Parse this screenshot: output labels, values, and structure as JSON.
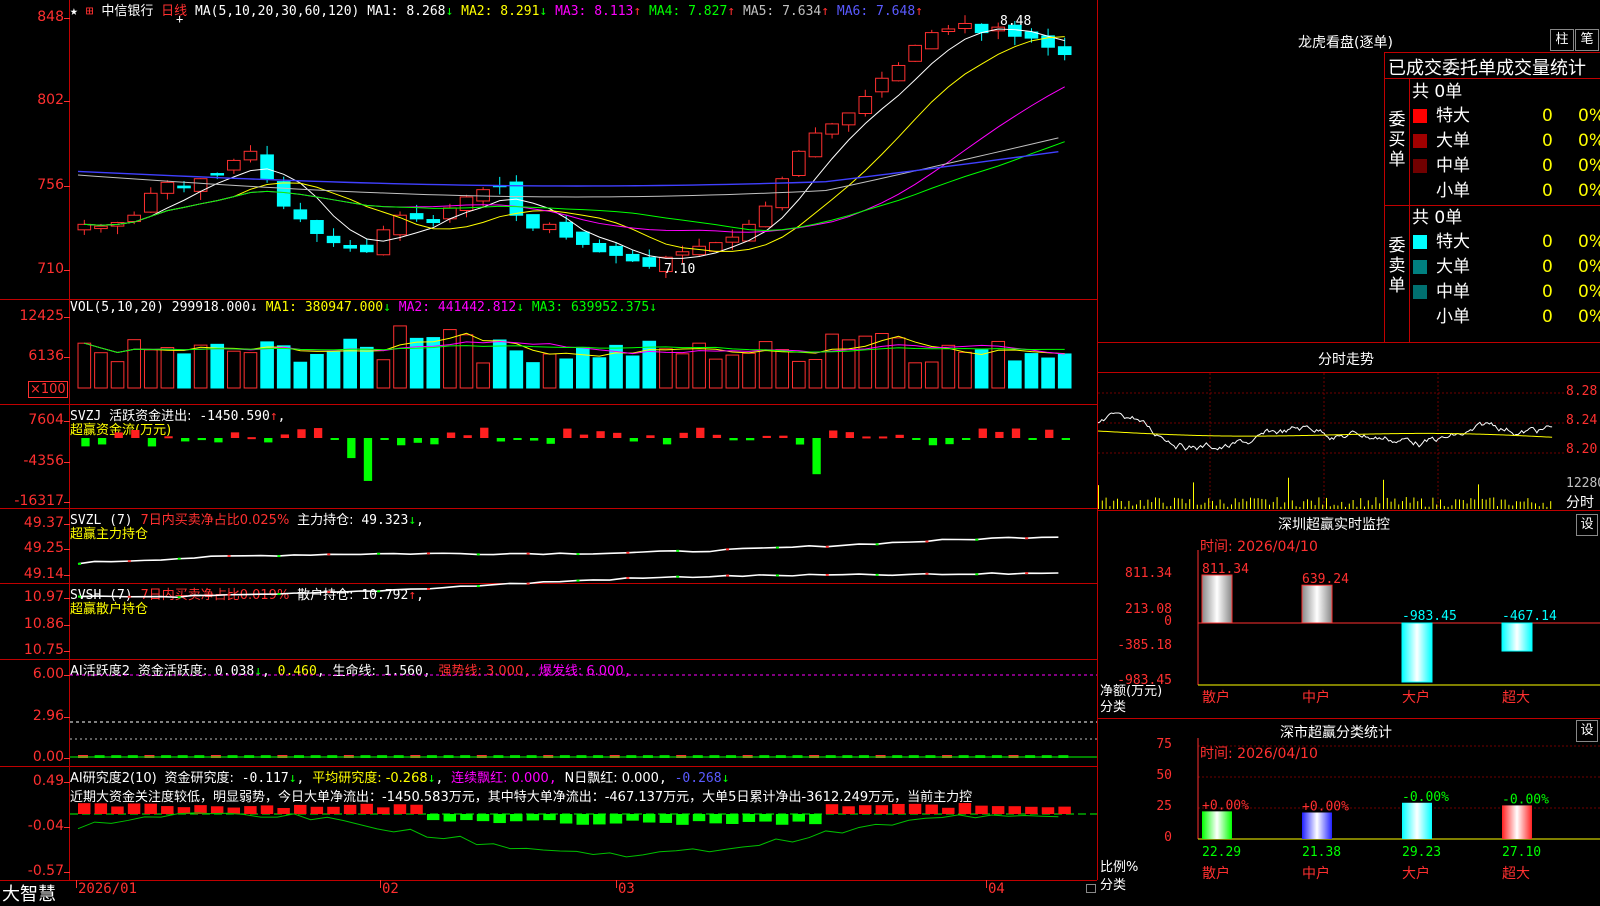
{
  "stock": {
    "star": "★",
    "plus_icon": "plus-square-icon",
    "name": "中信银行",
    "period": "日线"
  },
  "ma_header": {
    "label": "MA(5,10,20,30,60,120)",
    "items": [
      {
        "label": "MA1:",
        "value": "8.268",
        "arrow": "↓",
        "color": "#ffffff"
      },
      {
        "label": "MA2:",
        "value": "8.291",
        "arrow": "↓",
        "color": "#ffff00"
      },
      {
        "label": "MA3:",
        "value": "8.113",
        "arrow": "↑",
        "color": "#ff00ff"
      },
      {
        "label": "MA4:",
        "value": "7.827",
        "arrow": "↑",
        "color": "#00ff00"
      },
      {
        "label": "MA5:",
        "value": "7.634",
        "arrow": "↑",
        "color": "#c0c0c0"
      },
      {
        "label": "MA6:",
        "value": "7.648",
        "arrow": "↑",
        "color": "#5a5aff"
      }
    ]
  },
  "price_axis": [
    "848",
    "802",
    "756",
    "710"
  ],
  "price_annotations": {
    "high": "8.48",
    "low": "7.10"
  },
  "vol": {
    "header_label": "VOL(5,10,20)",
    "header_value": "299918.000",
    "header_arrow": "↓",
    "ma": [
      {
        "label": "MA1:",
        "value": "380947.000",
        "arrow": "↓",
        "color": "#ffff00"
      },
      {
        "label": "MA2:",
        "value": "441442.812",
        "arrow": "↓",
        "color": "#ff00ff"
      },
      {
        "label": "MA3:",
        "value": "639952.375",
        "arrow": "↓",
        "color": "#00ff00"
      }
    ],
    "axis": [
      "12425",
      "6136"
    ],
    "unit": "×100"
  },
  "svzj": {
    "title": "SVZJ",
    "label": "活跃资金进出:",
    "value": "-1450.590",
    "arrow": "↑",
    "sub": "超赢资金流(万元)",
    "axis": [
      "7604",
      "-4356",
      "-16317"
    ]
  },
  "svzl": {
    "title": "SVZL (7)",
    "label": "7日内买卖净占比0.025%",
    "label2": "主力持仓:",
    "value": "49.323",
    "arrow": "↓",
    "sub": "超赢主力持仓",
    "axis": [
      "49.37",
      "49.25",
      "49.14"
    ]
  },
  "svsh": {
    "title": "SVSH (7)",
    "label": "7日内买卖净占比0.019%",
    "label2": "散户持仓:",
    "value": "10.792",
    "arrow": "↑",
    "sub": "超赢散户持仓",
    "axis": [
      "10.97",
      "10.86",
      "10.75"
    ]
  },
  "ai_active": {
    "title": "AI活跃度2",
    "label": "资金活跃度:",
    "value1": "0.038",
    "arrow1": "↓",
    "value2": "0.460",
    "life_label": "生命线:",
    "life_value": "1.560",
    "strong": "强势线: 3.000",
    "burst": "爆发线: 6.000",
    "axis": [
      "6.00",
      "2.96",
      "0.00"
    ]
  },
  "ai_research": {
    "title": "AI研究度2(10)",
    "label": "资金研究度:",
    "value": "-0.117",
    "arrow": "↓",
    "avg": "平均研究度: -0.268",
    "avg_arrow": "↓",
    "cont": "连续飘红: 0.000",
    "nday": "N日飘红: 0.000",
    "last": "-0.268",
    "last_arrow": "↓",
    "comment": "近期大资金关注度较低，明显弱势，今日大单净流出：-1450.583万元，其中特大单净流出：-467.137万元，大单5日累计净出-3612.249万元，当前主力控",
    "axis": [
      "0.49",
      "-0.04",
      "-0.57"
    ]
  },
  "dates": [
    "2026/01",
    "02",
    "03",
    "04"
  ],
  "brand": "大智慧",
  "right": {
    "lhb_title": "龙虎看盘(逐单)",
    "btn_zhu": "柱",
    "btn_bi": "笔",
    "tabs_text": "已成交委托单成交量统计",
    "buy_side": "委买单",
    "sell_side": "委卖单",
    "buy_total": "共 0单",
    "sell_total": "共 0单",
    "buy_rows": [
      {
        "label": "特大",
        "count": "0",
        "pct": "0%",
        "color": "#ff0000"
      },
      {
        "label": "大单",
        "count": "0",
        "pct": "0%",
        "color": "#a00000"
      },
      {
        "label": "中单",
        "count": "0",
        "pct": "0%",
        "color": "#700000"
      },
      {
        "label": "小单",
        "count": "0",
        "pct": "0%",
        "color": ""
      }
    ],
    "sell_rows": [
      {
        "label": "特大",
        "count": "0",
        "pct": "0%",
        "color": "#00ffff"
      },
      {
        "label": "大单",
        "count": "0",
        "pct": "0%",
        "color": "#008080"
      },
      {
        "label": "中单",
        "count": "0",
        "pct": "0%",
        "color": "#007070"
      },
      {
        "label": "小单",
        "count": "0",
        "pct": "0%",
        "color": ""
      }
    ],
    "intraday_title": "分时走势",
    "intraday_axis": [
      "8.28",
      "8.24",
      "8.20"
    ],
    "intraday_vol": "12280",
    "intraday_label": "分时",
    "monitor_title": "深圳超赢实时监控",
    "monitor_setting": "设",
    "monitor_time": "时间: 2026/04/10",
    "monitor_axis": [
      "811.34",
      "213.08",
      "0",
      "-385.18",
      "-983.45"
    ],
    "monitor_ylabel": "净额(万元)",
    "monitor_xlabel": "分类",
    "classify_title": "深市超赢分类统计",
    "classify_setting": "设",
    "classify_time": "时间: 2026/04/10",
    "classify_axis": [
      "75",
      "50",
      "25",
      "0"
    ],
    "classify_ylabel": "比例%",
    "classify_xlabel": "分类"
  },
  "chart_data": [
    {
      "type": "bar",
      "title": "深圳超赢实时监控",
      "ylabel": "净额(万元)",
      "xlabel": "分类",
      "categories": [
        "散户",
        "中户",
        "大户",
        "超大"
      ],
      "values": [
        811.34,
        639.24,
        -983.45,
        -467.14
      ],
      "ylim": [
        -983.45,
        811.34
      ]
    },
    {
      "type": "bar",
      "title": "深市超赢分类统计",
      "ylabel": "比例%",
      "xlabel": "分类",
      "categories": [
        "散户",
        "中户",
        "大户",
        "超大"
      ],
      "values": [
        22.29,
        21.38,
        29.23,
        27.1
      ],
      "change_labels": [
        "+0.00%",
        "+0.00%",
        "-0.00%",
        "-0.00%"
      ],
      "ylim": [
        0,
        75
      ]
    }
  ]
}
